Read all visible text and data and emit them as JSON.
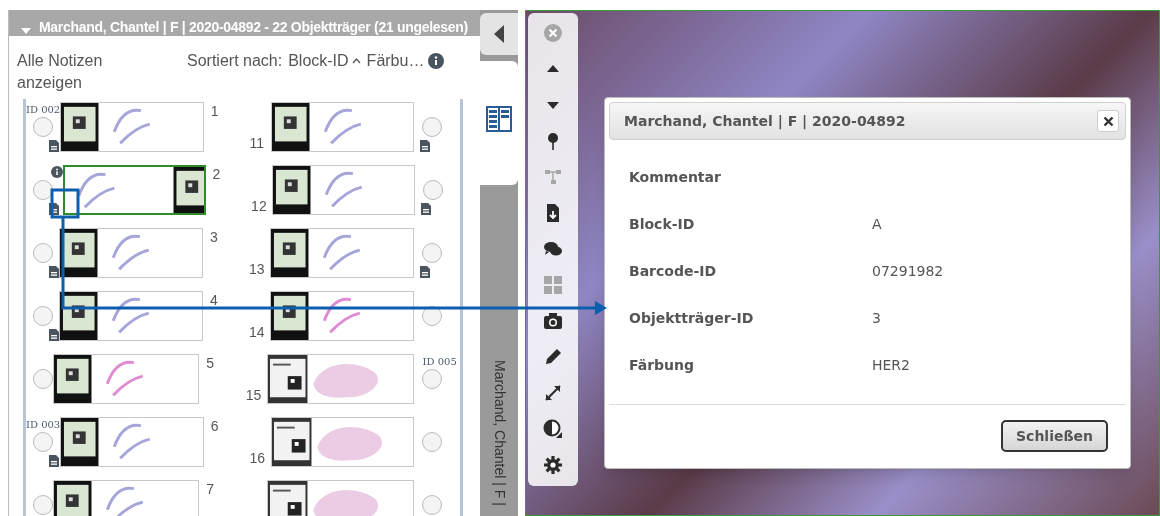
{
  "panel": {
    "title": "Marchand, Chantel | F | 2020-04892 - 22 Objektträger (21 ungelesen)",
    "show_notes_link": "Alle Notizen anzeigen",
    "sort_label": "Sortiert nach:",
    "sort_keys": [
      {
        "label": "Block-ID",
        "ascending": true
      },
      {
        "label": "Färbu…"
      }
    ]
  },
  "side_tab": {
    "text": "Marchand, Chantel | F |"
  },
  "slides": {
    "left": [
      {
        "number": "1",
        "kind": "ihc",
        "label_right": false,
        "selected": false,
        "checked": false,
        "note": true,
        "info": false,
        "group_label": "ID 002"
      },
      {
        "number": "2",
        "kind": "ihc",
        "label_right": true,
        "selected": true,
        "checked": false,
        "note": true,
        "info": true
      },
      {
        "number": "3",
        "kind": "ihc",
        "label_right": false,
        "selected": false,
        "checked": false,
        "note": true,
        "info": false
      },
      {
        "number": "4",
        "kind": "ihc",
        "label_right": false,
        "selected": false,
        "checked": false,
        "note": true,
        "info": false
      },
      {
        "number": "5",
        "kind": "he",
        "label_right": false,
        "selected": false,
        "checked": false,
        "note": false,
        "info": false
      },
      {
        "number": "6",
        "kind": "ihc",
        "label_right": false,
        "selected": false,
        "checked": false,
        "note": true,
        "info": false,
        "group_label": "ID 003"
      },
      {
        "number": "7",
        "kind": "ihc",
        "label_right": false,
        "selected": false,
        "checked": false,
        "note": false,
        "info": false
      }
    ],
    "right": [
      {
        "number": "11",
        "kind": "ihc",
        "label_right": false,
        "selected": false,
        "checked": false,
        "note": true,
        "info": false
      },
      {
        "number": "12",
        "kind": "ihc",
        "label_right": false,
        "selected": false,
        "checked": false,
        "note": true,
        "info": false
      },
      {
        "number": "13",
        "kind": "ihc",
        "label_right": false,
        "selected": false,
        "checked": false,
        "note": true,
        "info": false
      },
      {
        "number": "14",
        "kind": "he",
        "label_right": false,
        "selected": false,
        "checked": false,
        "note": false,
        "info": false
      },
      {
        "number": "15",
        "kind": "section",
        "label_right": false,
        "selected": false,
        "checked": false,
        "note": false,
        "info": false,
        "group_label": "ID 005"
      },
      {
        "number": "16",
        "kind": "section",
        "label_right": false,
        "selected": false,
        "checked": false,
        "note": false,
        "info": false
      },
      {
        "kind": "section",
        "label_right": false,
        "selected": false,
        "checked": false,
        "note": false,
        "info": false
      }
    ]
  },
  "tools": [
    {
      "kind": "close",
      "disabled": true
    },
    {
      "kind": "up",
      "disabled": false
    },
    {
      "kind": "down",
      "disabled": false
    },
    {
      "kind": "pin",
      "disabled": false
    },
    {
      "kind": "tree",
      "disabled": true
    },
    {
      "kind": "download",
      "disabled": false
    },
    {
      "kind": "chat",
      "disabled": false
    },
    {
      "kind": "grid",
      "disabled": true
    },
    {
      "kind": "camera",
      "disabled": false
    },
    {
      "kind": "pencil",
      "disabled": false
    },
    {
      "kind": "expand",
      "disabled": false
    },
    {
      "kind": "contrast",
      "disabled": false
    },
    {
      "kind": "gear",
      "disabled": false
    }
  ],
  "dialog": {
    "title": "Marchand, Chantel | F | 2020-04892",
    "fields": [
      {
        "label": "Kommentar"
      },
      {
        "label": "Block-ID",
        "value": "A"
      },
      {
        "label": "Barcode-ID",
        "value": "07291982"
      },
      {
        "label": "Objektträger-ID",
        "value": "3"
      },
      {
        "label": "Färbung",
        "value": "HER2"
      }
    ],
    "button": "Schließen"
  }
}
